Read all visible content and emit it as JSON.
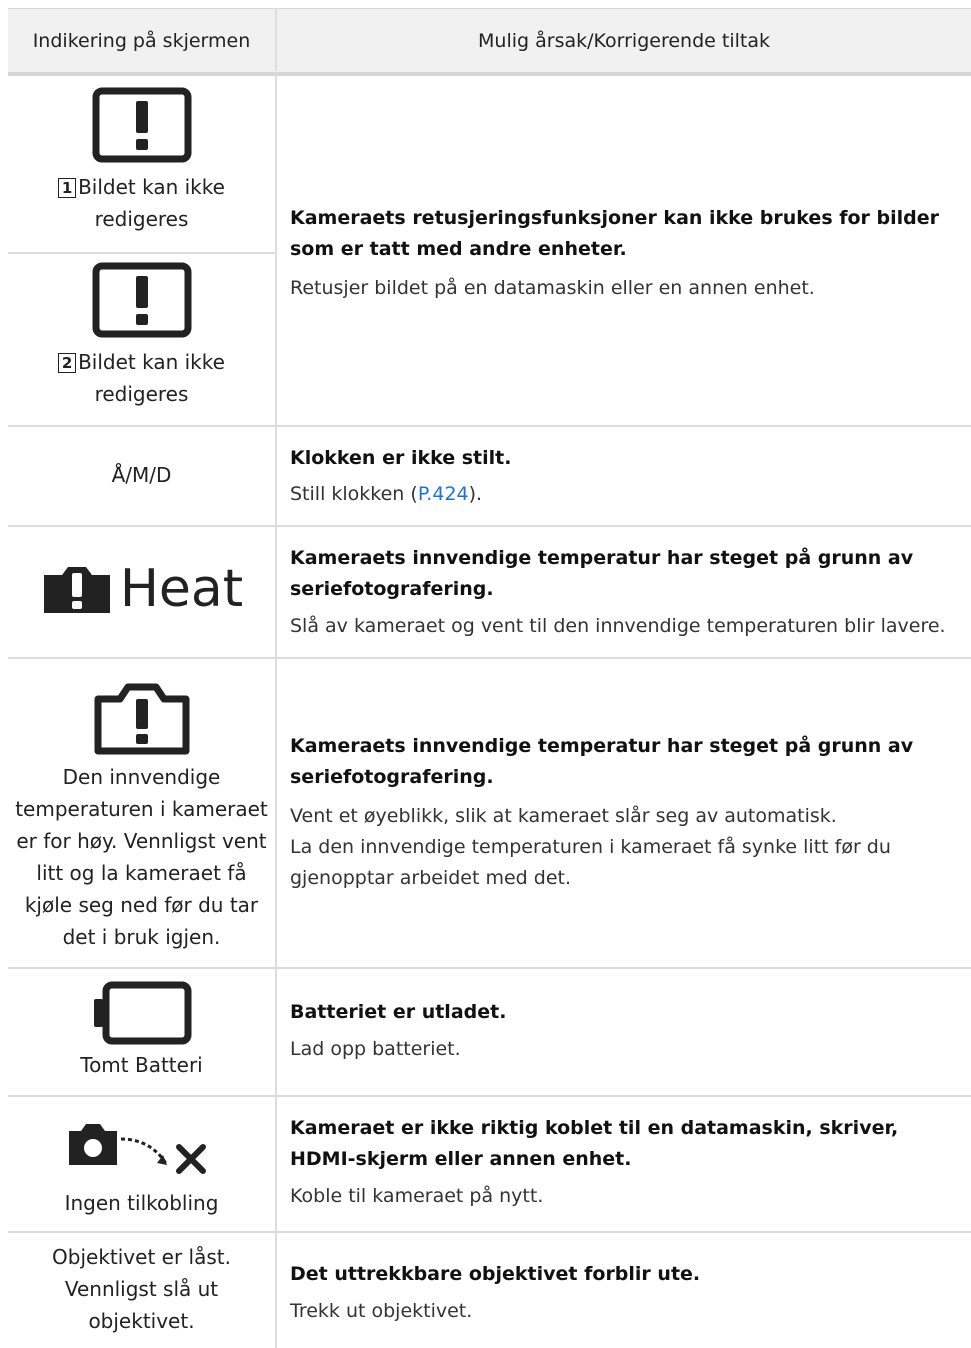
{
  "header": {
    "col1": "Indikering på skjermen",
    "col2": "Mulig årsak/Korrigerende tiltak"
  },
  "rows": {
    "edit": {
      "item1_num": "1",
      "item1_label_l1": "Bildet kan ikke",
      "item1_label_l2": "redigeres",
      "item2_num": "2",
      "item2_label_l1": "Bildet kan ikke",
      "item2_label_l2": "redigeres",
      "cause": "Kameraets retusjeringsfunksjoner kan ikke brukes for bilder som er tatt med andre enheter.",
      "action": "Retusjer bildet på en datamaskin eller en annen enhet."
    },
    "clock": {
      "indicator": "Å/M/D",
      "cause": "Klokken er ikke stilt.",
      "action_pre": "Still klokken (",
      "action_link": "P.424",
      "action_post": ")."
    },
    "heat": {
      "indicator_text": "Heat",
      "cause": "Kameraets innvendige temperatur har steget på grunn av seriefotografering.",
      "action": "Slå av kameraet og vent til den innvendige temperaturen blir lavere."
    },
    "temp": {
      "label_lines": [
        "Den innvendige",
        "temperaturen i kameraet",
        "er for høy. Vennligst vent",
        "litt og la kameraet få",
        "kjøle seg ned før du tar",
        "det i bruk igjen."
      ],
      "cause": "Kameraets innvendige temperatur har steget på grunn av seriefotografering.",
      "action1": "Vent et øyeblikk, slik at kameraet slår seg av automatisk.",
      "action2": "La den innvendige temperaturen i kameraet få synke litt før du gjenopptar arbeidet med det."
    },
    "battery": {
      "label": "Tomt Batteri",
      "cause": "Batteriet er utladet.",
      "action": "Lad opp batteriet."
    },
    "connection": {
      "label": "Ingen tilkobling",
      "cause": "Kameraet er ikke riktig koblet til en datamaskin, skriver, HDMI-skjerm eller annen enhet.",
      "action": "Koble til kameraet på nytt."
    },
    "lens": {
      "label_lines": [
        "Objektivet er låst.",
        "Vennligst slå ut",
        "objektivet."
      ],
      "cause": "Det uttrekkbare objektivet forblir ute.",
      "action": "Trekk ut objektivet."
    }
  },
  "icons": {
    "edit1": "warning-box-icon",
    "edit2": "warning-box-icon",
    "heat": "camera-warning-heat-icon",
    "temp": "camera-warning-icon",
    "battery": "empty-battery-icon",
    "connection": "camera-disconnected-icon"
  },
  "colors": {
    "link": "#1a73d9",
    "header_bg": "#f1f1f1"
  }
}
